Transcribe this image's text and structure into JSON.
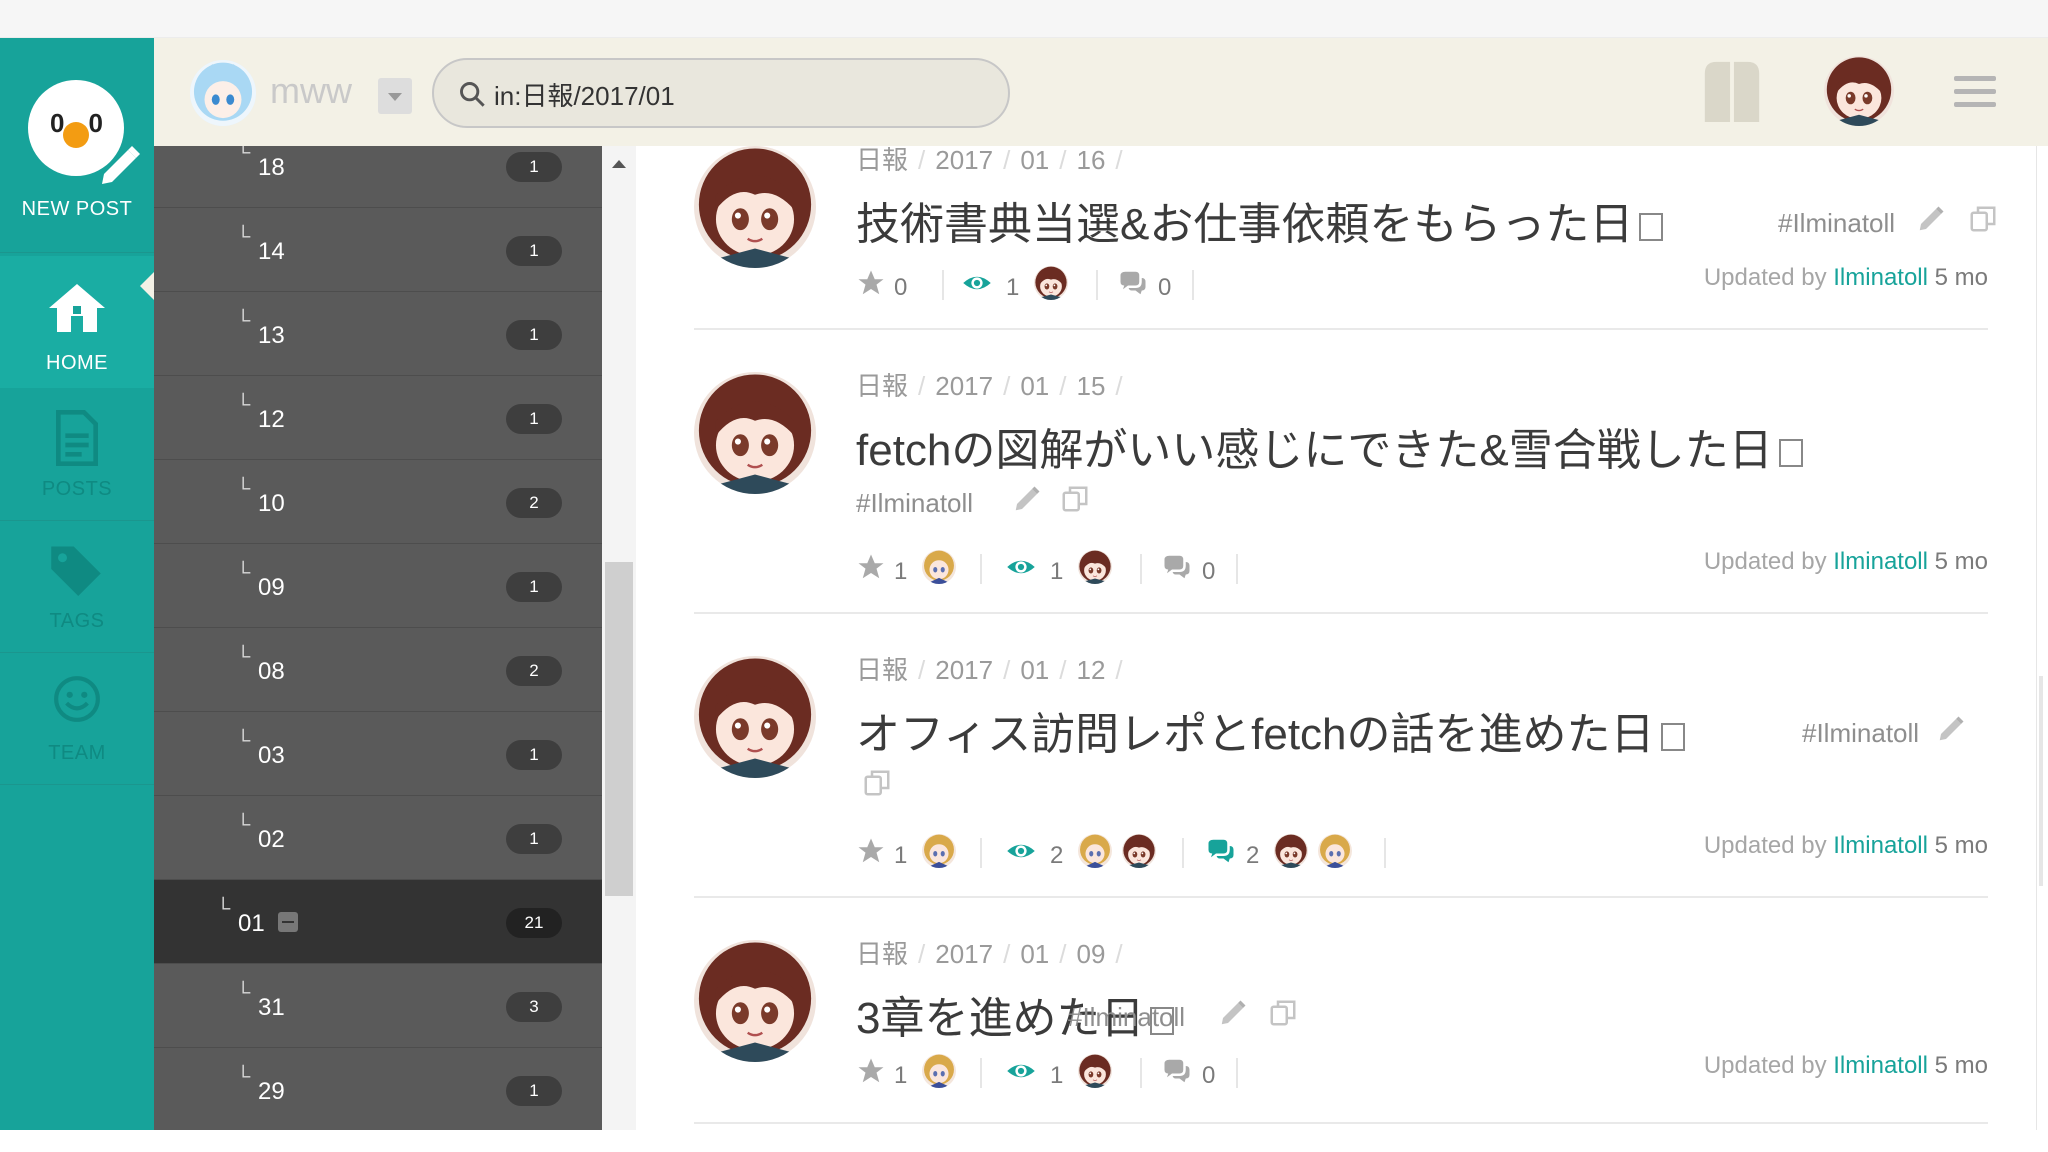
{
  "colors": {
    "brand": "#17a39a",
    "header_bg": "#f3f1e6",
    "tree_bg": "#5a5a5a",
    "tree_active": "#333333"
  },
  "nav": {
    "new_post_label": "NEW POST",
    "items": [
      {
        "label": "HOME",
        "icon": "home-icon",
        "active": true
      },
      {
        "label": "POSTS",
        "icon": "document-icon",
        "active": false
      },
      {
        "label": "TAGS",
        "icon": "tag-icon",
        "active": false
      },
      {
        "label": "TEAM",
        "icon": "smile-icon",
        "active": false
      }
    ]
  },
  "header": {
    "team_name": "mww",
    "search_value": "in:日報/2017/01",
    "icons": [
      "search-icon",
      "book-icon",
      "user-avatar",
      "hamburger-icon"
    ]
  },
  "tree": {
    "rows": [
      {
        "name": "18",
        "count": "1"
      },
      {
        "name": "14",
        "count": "1"
      },
      {
        "name": "13",
        "count": "1"
      },
      {
        "name": "12",
        "count": "1"
      },
      {
        "name": "10",
        "count": "2"
      },
      {
        "name": "09",
        "count": "1"
      },
      {
        "name": "08",
        "count": "2"
      },
      {
        "name": "03",
        "count": "1"
      },
      {
        "name": "02",
        "count": "1"
      },
      {
        "name": "01",
        "count": "21",
        "active": true
      },
      {
        "name": "31",
        "count": "3"
      },
      {
        "name": "29",
        "count": "1"
      }
    ]
  },
  "posts": [
    {
      "crumbs": [
        "日報",
        "2017",
        "01",
        "16"
      ],
      "title": "技術書典当選&お仕事依頼をもらった日",
      "tag": "#Ilminatoll",
      "stars": "0",
      "views": "1",
      "comments": "0",
      "updated_prefix": "Updated by",
      "updated_by": "Ilminatoll",
      "updated_ago": "5 mo"
    },
    {
      "crumbs": [
        "日報",
        "2017",
        "01",
        "15"
      ],
      "title": "fetchの図解がいい感じにできた&雪合戦した日",
      "tag": "#Ilminatoll",
      "stars": "1",
      "views": "1",
      "comments": "0",
      "updated_prefix": "Updated by",
      "updated_by": "Ilminatoll",
      "updated_ago": "5 mo"
    },
    {
      "crumbs": [
        "日報",
        "2017",
        "01",
        "12"
      ],
      "title": "オフィス訪問レポとfetchの話を進めた日",
      "tag": "#Ilminatoll",
      "stars": "1",
      "views": "2",
      "comments": "2",
      "updated_prefix": "Updated by",
      "updated_by": "Ilminatoll",
      "updated_ago": "5 mo"
    },
    {
      "crumbs": [
        "日報",
        "2017",
        "01",
        "09"
      ],
      "title": "3章を進めた日",
      "tag": "#Ilminatoll",
      "stars": "1",
      "views": "1",
      "comments": "0",
      "updated_prefix": "Updated by",
      "updated_by": "Ilminatoll",
      "updated_ago": "5 mo"
    }
  ]
}
